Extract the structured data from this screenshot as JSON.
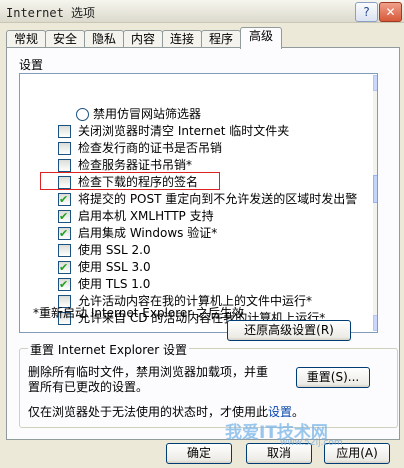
{
  "window": {
    "title": "Internet 选项",
    "help_label": "?",
    "close_label": "✕"
  },
  "tabs": [
    {
      "label": "常规"
    },
    {
      "label": "安全"
    },
    {
      "label": "隐私"
    },
    {
      "label": "内容"
    },
    {
      "label": "连接"
    },
    {
      "label": "程序"
    },
    {
      "label": "高级",
      "active": true
    }
  ],
  "settings": {
    "label": "设置",
    "items": [
      {
        "type": "radio",
        "label": "禁用仿冒网站筛选器",
        "checked": false
      },
      {
        "type": "checkbox",
        "label": "关闭浏览器时清空 Internet 临时文件夹",
        "checked": false
      },
      {
        "type": "checkbox",
        "label": "检查发行商的证书是否吊销",
        "checked": false
      },
      {
        "type": "checkbox",
        "label": "检查服务器证书吊销*",
        "checked": false
      },
      {
        "type": "checkbox",
        "label": "检查下载的程序的签名",
        "checked": false,
        "highlighted": true
      },
      {
        "type": "checkbox",
        "label": "将提交的 POST 重定向到不允许发送的区域时发出警",
        "checked": true
      },
      {
        "type": "checkbox",
        "label": "启用本机 XMLHTTP 支持",
        "checked": true
      },
      {
        "type": "checkbox",
        "label": "启用集成 Windows 验证*",
        "checked": true
      },
      {
        "type": "checkbox",
        "label": "使用 SSL 2.0",
        "checked": false
      },
      {
        "type": "checkbox",
        "label": "使用 SSL 3.0",
        "checked": true
      },
      {
        "type": "checkbox",
        "label": "使用 TLS 1.0",
        "checked": true
      },
      {
        "type": "checkbox",
        "label": "允许活动内容在我的计算机上的文件中运行*",
        "checked": false
      },
      {
        "type": "checkbox",
        "label": "允许来自 CD 的活动内容在我的计算机上运行*",
        "checked": false
      }
    ],
    "restart_note": "*重新启动 Internet Explorer 之后生效",
    "restore_button": "还原高级设置(R)"
  },
  "reset_group": {
    "title": "重置 Internet Explorer 设置",
    "description_line1": "删除所有临时文件，禁用浏览器加载项，并重",
    "description_line2": "置所有已更改的设置。",
    "reset_button": "重置(S)...",
    "broken_prefix": "仅在浏览器处于无法使用的状态时，才使用此",
    "broken_link": "设置",
    "broken_suffix": "。"
  },
  "footer": {
    "ok_button": "确定",
    "cancel_button": "取消",
    "apply_button": "应用(A)"
  },
  "watermark": {
    "text": "我爱IT技术网",
    "url": "www.52ij.com"
  }
}
